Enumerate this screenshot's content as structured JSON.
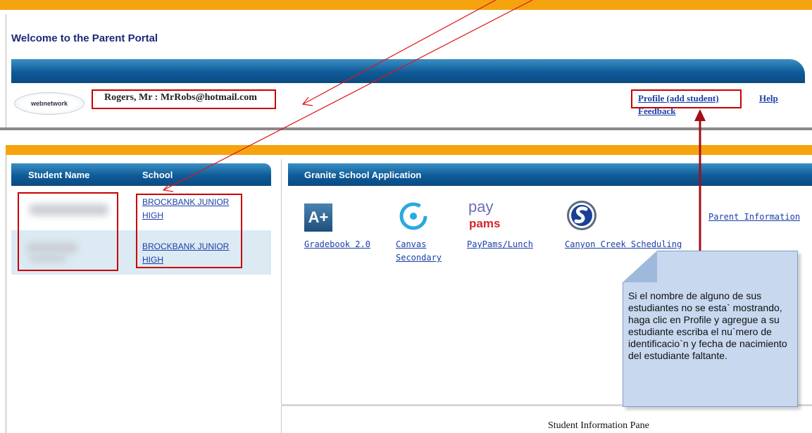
{
  "header": {
    "title": "Welcome to the Parent Portal",
    "logo_text": "webnetwork",
    "user_info": "Rogers, Mr : MrRobs@hotmail.com",
    "links": {
      "profile": "Profile (add student)",
      "help": "Help",
      "feedback": "Feedback"
    }
  },
  "students_panel": {
    "columns": [
      "Student Name",
      "School"
    ],
    "rows": [
      {
        "school": "BROCKBANK JUNIOR HIGH"
      },
      {
        "school": "BROCKBANK JUNIOR HIGH"
      }
    ]
  },
  "apps_panel": {
    "title": "Granite School Application",
    "apps": [
      {
        "label": "Gradebook 2.0",
        "icon": "gradebook-aplus-icon",
        "icon_text": "A+"
      },
      {
        "label_line1": "Canvas",
        "label_line2": "Secondary",
        "icon": "canvas-icon"
      },
      {
        "label": "PayPams/Lunch",
        "icon": "paypams-icon",
        "icon_text_1": "pay",
        "icon_text_2": "pams"
      },
      {
        "label": "Canyon Creek Scheduling",
        "icon": "canyon-creek-icon"
      }
    ],
    "parent_information": "Parent Information"
  },
  "annotation": {
    "note_text": "Si el nombre de alguno de sus estudiantes no se esta` mostrando, haga clic en Profile y agregue a su estudiante escriba el nu`mero de identificacio`n y fecha de nacimiento del estudiante faltante."
  },
  "footer": {
    "student_information_pane": "Student Information Pane"
  },
  "colors": {
    "orange_bar": "#f5a40f",
    "header_blue": "#0e5b98",
    "link_blue": "#1a3fa8",
    "annotation_red": "#c80000",
    "note_fill": "#c7d8ef"
  }
}
